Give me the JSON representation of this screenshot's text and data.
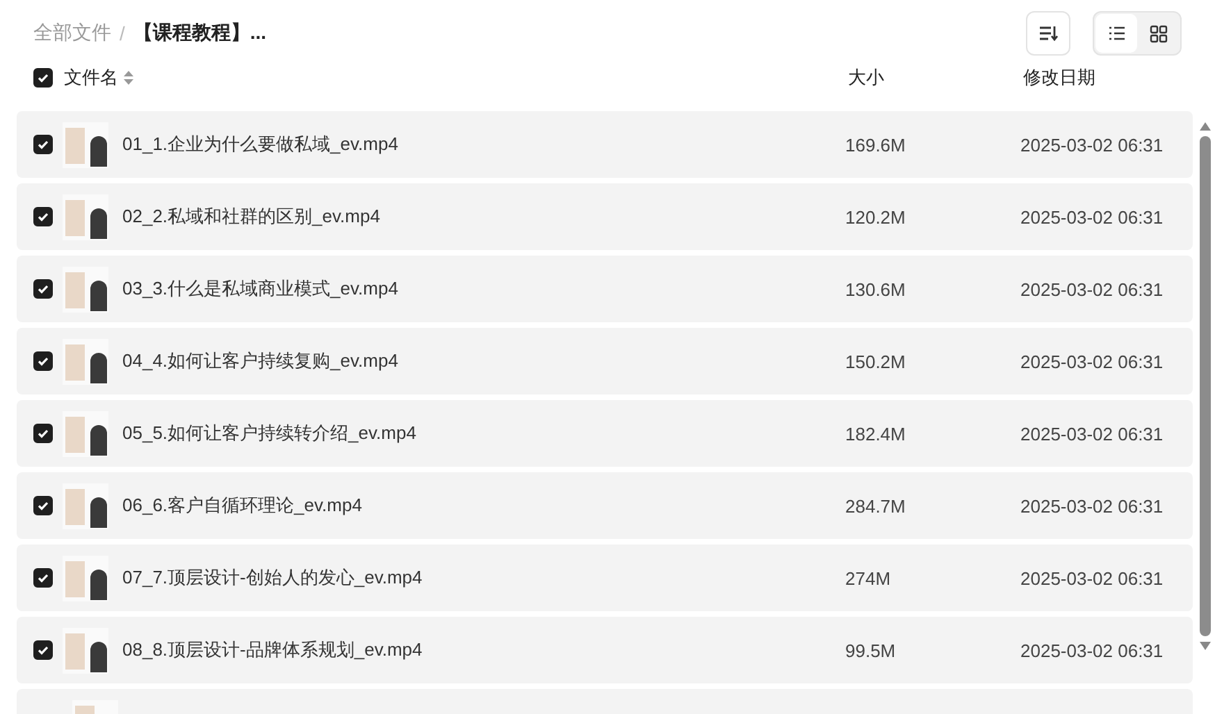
{
  "breadcrumb": {
    "separator": "/",
    "items": [
      {
        "label": "全部文件",
        "current": false
      },
      {
        "label": "【课程教程】...",
        "current": true
      }
    ]
  },
  "view_modes": [
    {
      "kind": "list",
      "selected": true
    },
    {
      "kind": "grid",
      "selected": false
    }
  ],
  "header": {
    "checked": true,
    "columns": [
      "文件名",
      "大小",
      "修改日期"
    ]
  },
  "rows": [
    {
      "checked": true,
      "name": "01_1.企业为什么要做私域_ev.mp4",
      "size": "169.6M",
      "modified": "2025-03-02 06:31"
    },
    {
      "checked": true,
      "name": "02_2.私域和社群的区别_ev.mp4",
      "size": "120.2M",
      "modified": "2025-03-02 06:31"
    },
    {
      "checked": true,
      "name": "03_3.什么是私域商业模式_ev.mp4",
      "size": "130.6M",
      "modified": "2025-03-02 06:31"
    },
    {
      "checked": true,
      "name": "04_4.如何让客户持续复购_ev.mp4",
      "size": "150.2M",
      "modified": "2025-03-02 06:31"
    },
    {
      "checked": true,
      "name": "05_5.如何让客户持续转介绍_ev.mp4",
      "size": "182.4M",
      "modified": "2025-03-02 06:31"
    },
    {
      "checked": true,
      "name": "06_6.客户自循环理论_ev.mp4",
      "size": "284.7M",
      "modified": "2025-03-02 06:31"
    },
    {
      "checked": true,
      "name": "07_7.顶层设计-创始人的发心_ev.mp4",
      "size": "274M",
      "modified": "2025-03-02 06:31"
    },
    {
      "checked": true,
      "name": "08_8.顶层设计-品牌体系规划_ev.mp4",
      "size": "99.5M",
      "modified": "2025-03-02 06:31"
    },
    {
      "partial": true
    }
  ]
}
